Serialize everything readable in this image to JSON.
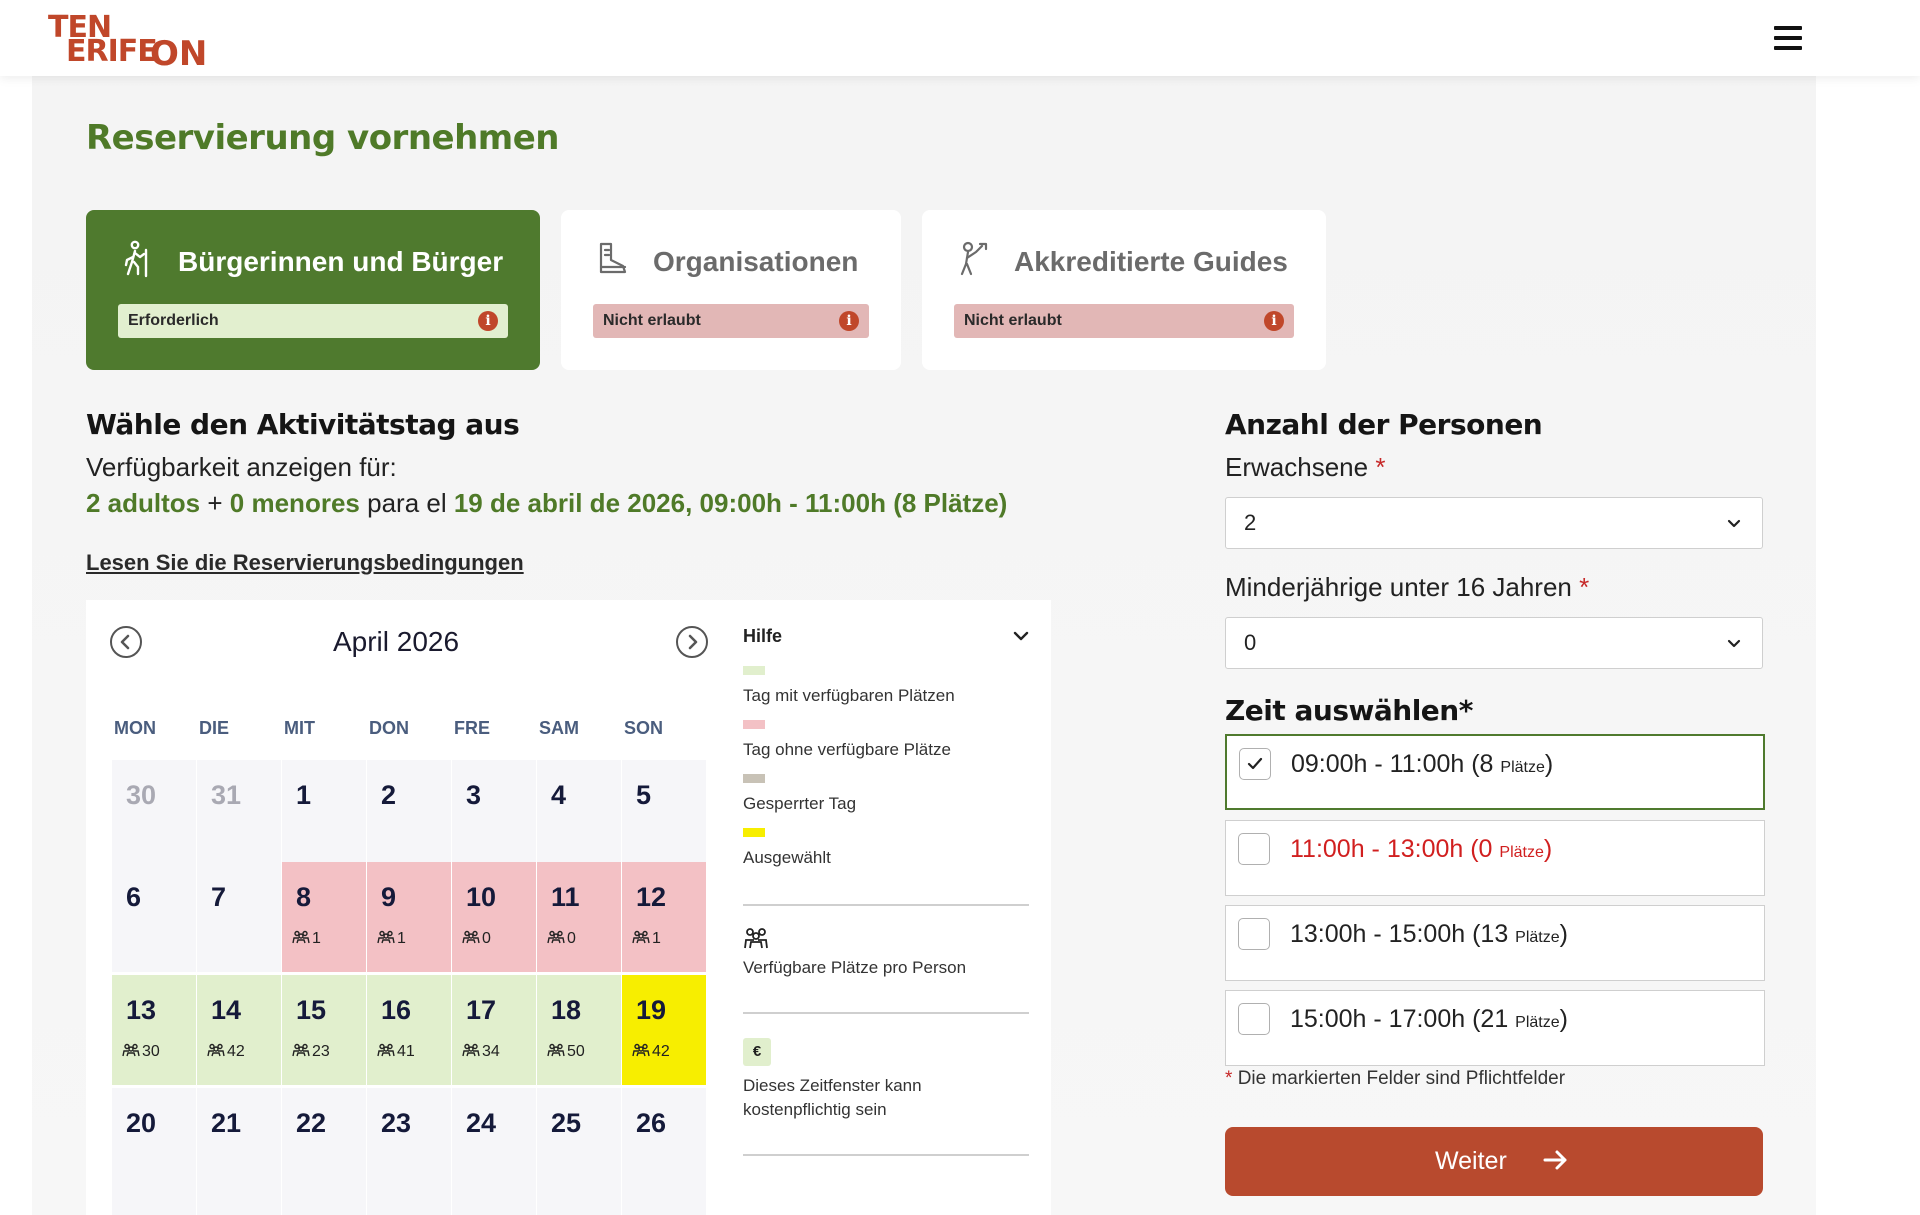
{
  "header": {
    "logo": {
      "line1": "TEN",
      "line2": "ERIFE",
      "line3": "ON"
    },
    "menu_icon": "hamburger-menu-icon"
  },
  "page": {
    "title": "Reservierung vornehmen"
  },
  "tabs": [
    {
      "label": "Bürgerinnen und Bürger",
      "badge": "Erforderlich",
      "icon": "hiker-icon",
      "active": true
    },
    {
      "label": "Organisationen",
      "badge": "Nicht erlaubt",
      "icon": "boot-icon",
      "active": false
    },
    {
      "label": "Akkreditierte Guides",
      "badge": "Nicht erlaubt",
      "icon": "guide-icon",
      "active": false
    }
  ],
  "info_glyph": "i",
  "day_section": {
    "title": "Wähle den Aktivitätstag aus",
    "availability_label": "Verfügbarkeit anzeigen für:",
    "adults": "2 adultos",
    "plus": "+",
    "minors": "0 menores",
    "para": "para el",
    "date_slot": "19 de abril de 2026, 09:00h - 11:00h (8 Plätze)",
    "conditions_link": "Lesen Sie die Reservierungsbedingungen"
  },
  "calendar": {
    "month": "April 2026",
    "weekdays": [
      "MON",
      "DIE",
      "MIT",
      "DON",
      "FRE",
      "SAM",
      "SON"
    ],
    "rows": [
      [
        {
          "n": "30",
          "state": "past",
          "count": ""
        },
        {
          "n": "31",
          "state": "past",
          "count": ""
        },
        {
          "n": "1",
          "state": "normal",
          "count": ""
        },
        {
          "n": "2",
          "state": "normal",
          "count": ""
        },
        {
          "n": "3",
          "state": "normal",
          "count": ""
        },
        {
          "n": "4",
          "state": "normal",
          "count": ""
        },
        {
          "n": "5",
          "state": "normal",
          "count": ""
        }
      ],
      [
        {
          "n": "6",
          "state": "normal",
          "count": ""
        },
        {
          "n": "7",
          "state": "normal",
          "count": ""
        },
        {
          "n": "8",
          "state": "red",
          "count": "1"
        },
        {
          "n": "9",
          "state": "red",
          "count": "1"
        },
        {
          "n": "10",
          "state": "red",
          "count": "0"
        },
        {
          "n": "11",
          "state": "red",
          "count": "0"
        },
        {
          "n": "12",
          "state": "red",
          "count": "1"
        }
      ],
      [
        {
          "n": "13",
          "state": "green",
          "count": "30"
        },
        {
          "n": "14",
          "state": "green",
          "count": "42"
        },
        {
          "n": "15",
          "state": "green",
          "count": "23"
        },
        {
          "n": "16",
          "state": "green",
          "count": "41"
        },
        {
          "n": "17",
          "state": "green",
          "count": "34"
        },
        {
          "n": "18",
          "state": "green",
          "count": "50"
        },
        {
          "n": "19",
          "state": "selected",
          "count": "42"
        }
      ],
      [
        {
          "n": "20",
          "state": "normal",
          "count": ""
        },
        {
          "n": "21",
          "state": "normal",
          "count": ""
        },
        {
          "n": "22",
          "state": "normal",
          "count": ""
        },
        {
          "n": "23",
          "state": "normal",
          "count": ""
        },
        {
          "n": "24",
          "state": "normal",
          "count": ""
        },
        {
          "n": "25",
          "state": "normal",
          "count": ""
        },
        {
          "n": "26",
          "state": "normal",
          "count": ""
        }
      ]
    ]
  },
  "help": {
    "title": "Hilfe",
    "legend": [
      {
        "color": "#e1efcd",
        "label": "Tag mit verfügbaren Plätzen"
      },
      {
        "color": "#f3c1c5",
        "label": "Tag ohne verfügbare Plätze"
      },
      {
        "color": "#c8c2b6",
        "label": "Gesperrter Tag"
      },
      {
        "color": "#f7ee00",
        "label": "Ausgewählt"
      }
    ],
    "per_person_label": "Verfügbare Plätze pro Person",
    "euro_symbol": "€",
    "paid_line1": "Dieses Zeitfenster kann",
    "paid_line2": "kostenpflichtig sein"
  },
  "persons": {
    "title": "Anzahl der Personen",
    "adults_label": "Erwachsene",
    "adults_value": "2",
    "minors_label": "Minderjährige unter 16 Jahren",
    "minors_value": "0",
    "required_mark": "*"
  },
  "time": {
    "title": "Zeit auswählen*",
    "slots": [
      {
        "time": "09:00h - 11:00h (8 ",
        "unit": "Plätze",
        "close": ")",
        "checked": true,
        "full": false
      },
      {
        "time": "11:00h - 13:00h (0 ",
        "unit": "Plätze",
        "close": ")",
        "checked": false,
        "full": true
      },
      {
        "time": "13:00h - 15:00h (13 ",
        "unit": "Plätze",
        "close": ")",
        "checked": false,
        "full": false
      },
      {
        "time": "15:00h - 17:00h (21 ",
        "unit": "Plätze",
        "close": ")",
        "checked": false,
        "full": false
      }
    ],
    "required_note": "Die markierten Felder sind Pflichtfelder"
  },
  "next_button": {
    "label": "Weiter"
  },
  "colors": {
    "brand_green": "#4f7a2e",
    "brand_red": "#b84a2e",
    "selected_yellow": "#f7ee00"
  }
}
